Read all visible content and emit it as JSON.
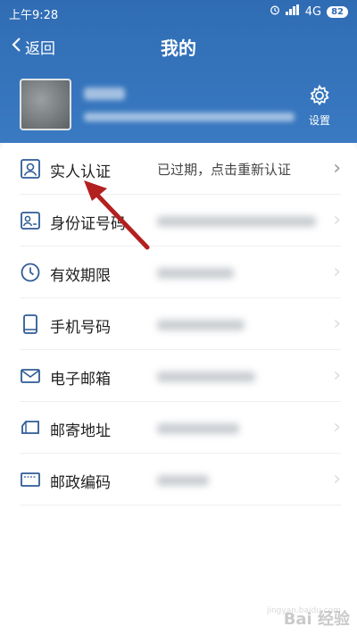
{
  "status": {
    "time": "上午9:28",
    "network": "4G",
    "battery": "82"
  },
  "nav": {
    "back_label": "返回",
    "title": "我的"
  },
  "settings": {
    "label": "设置"
  },
  "rows": [
    {
      "label": "实人认证",
      "value": "已过期，点击重新认证",
      "icon": "person-id-icon"
    },
    {
      "label": "身份证号码",
      "icon": "id-card-icon"
    },
    {
      "label": "有效期限",
      "icon": "clock-icon"
    },
    {
      "label": "手机号码",
      "icon": "phone-icon"
    },
    {
      "label": "电子邮箱",
      "icon": "mail-icon"
    },
    {
      "label": "邮寄地址",
      "icon": "truck-icon"
    },
    {
      "label": "邮政编码",
      "icon": "postcode-icon"
    }
  ],
  "watermark": {
    "text": "Bai 经验",
    "sub": "jingyan.baidu.com"
  },
  "colors": {
    "header": "#2f6cb4",
    "icon": "#2f5b96",
    "arrow": "#b32020"
  }
}
